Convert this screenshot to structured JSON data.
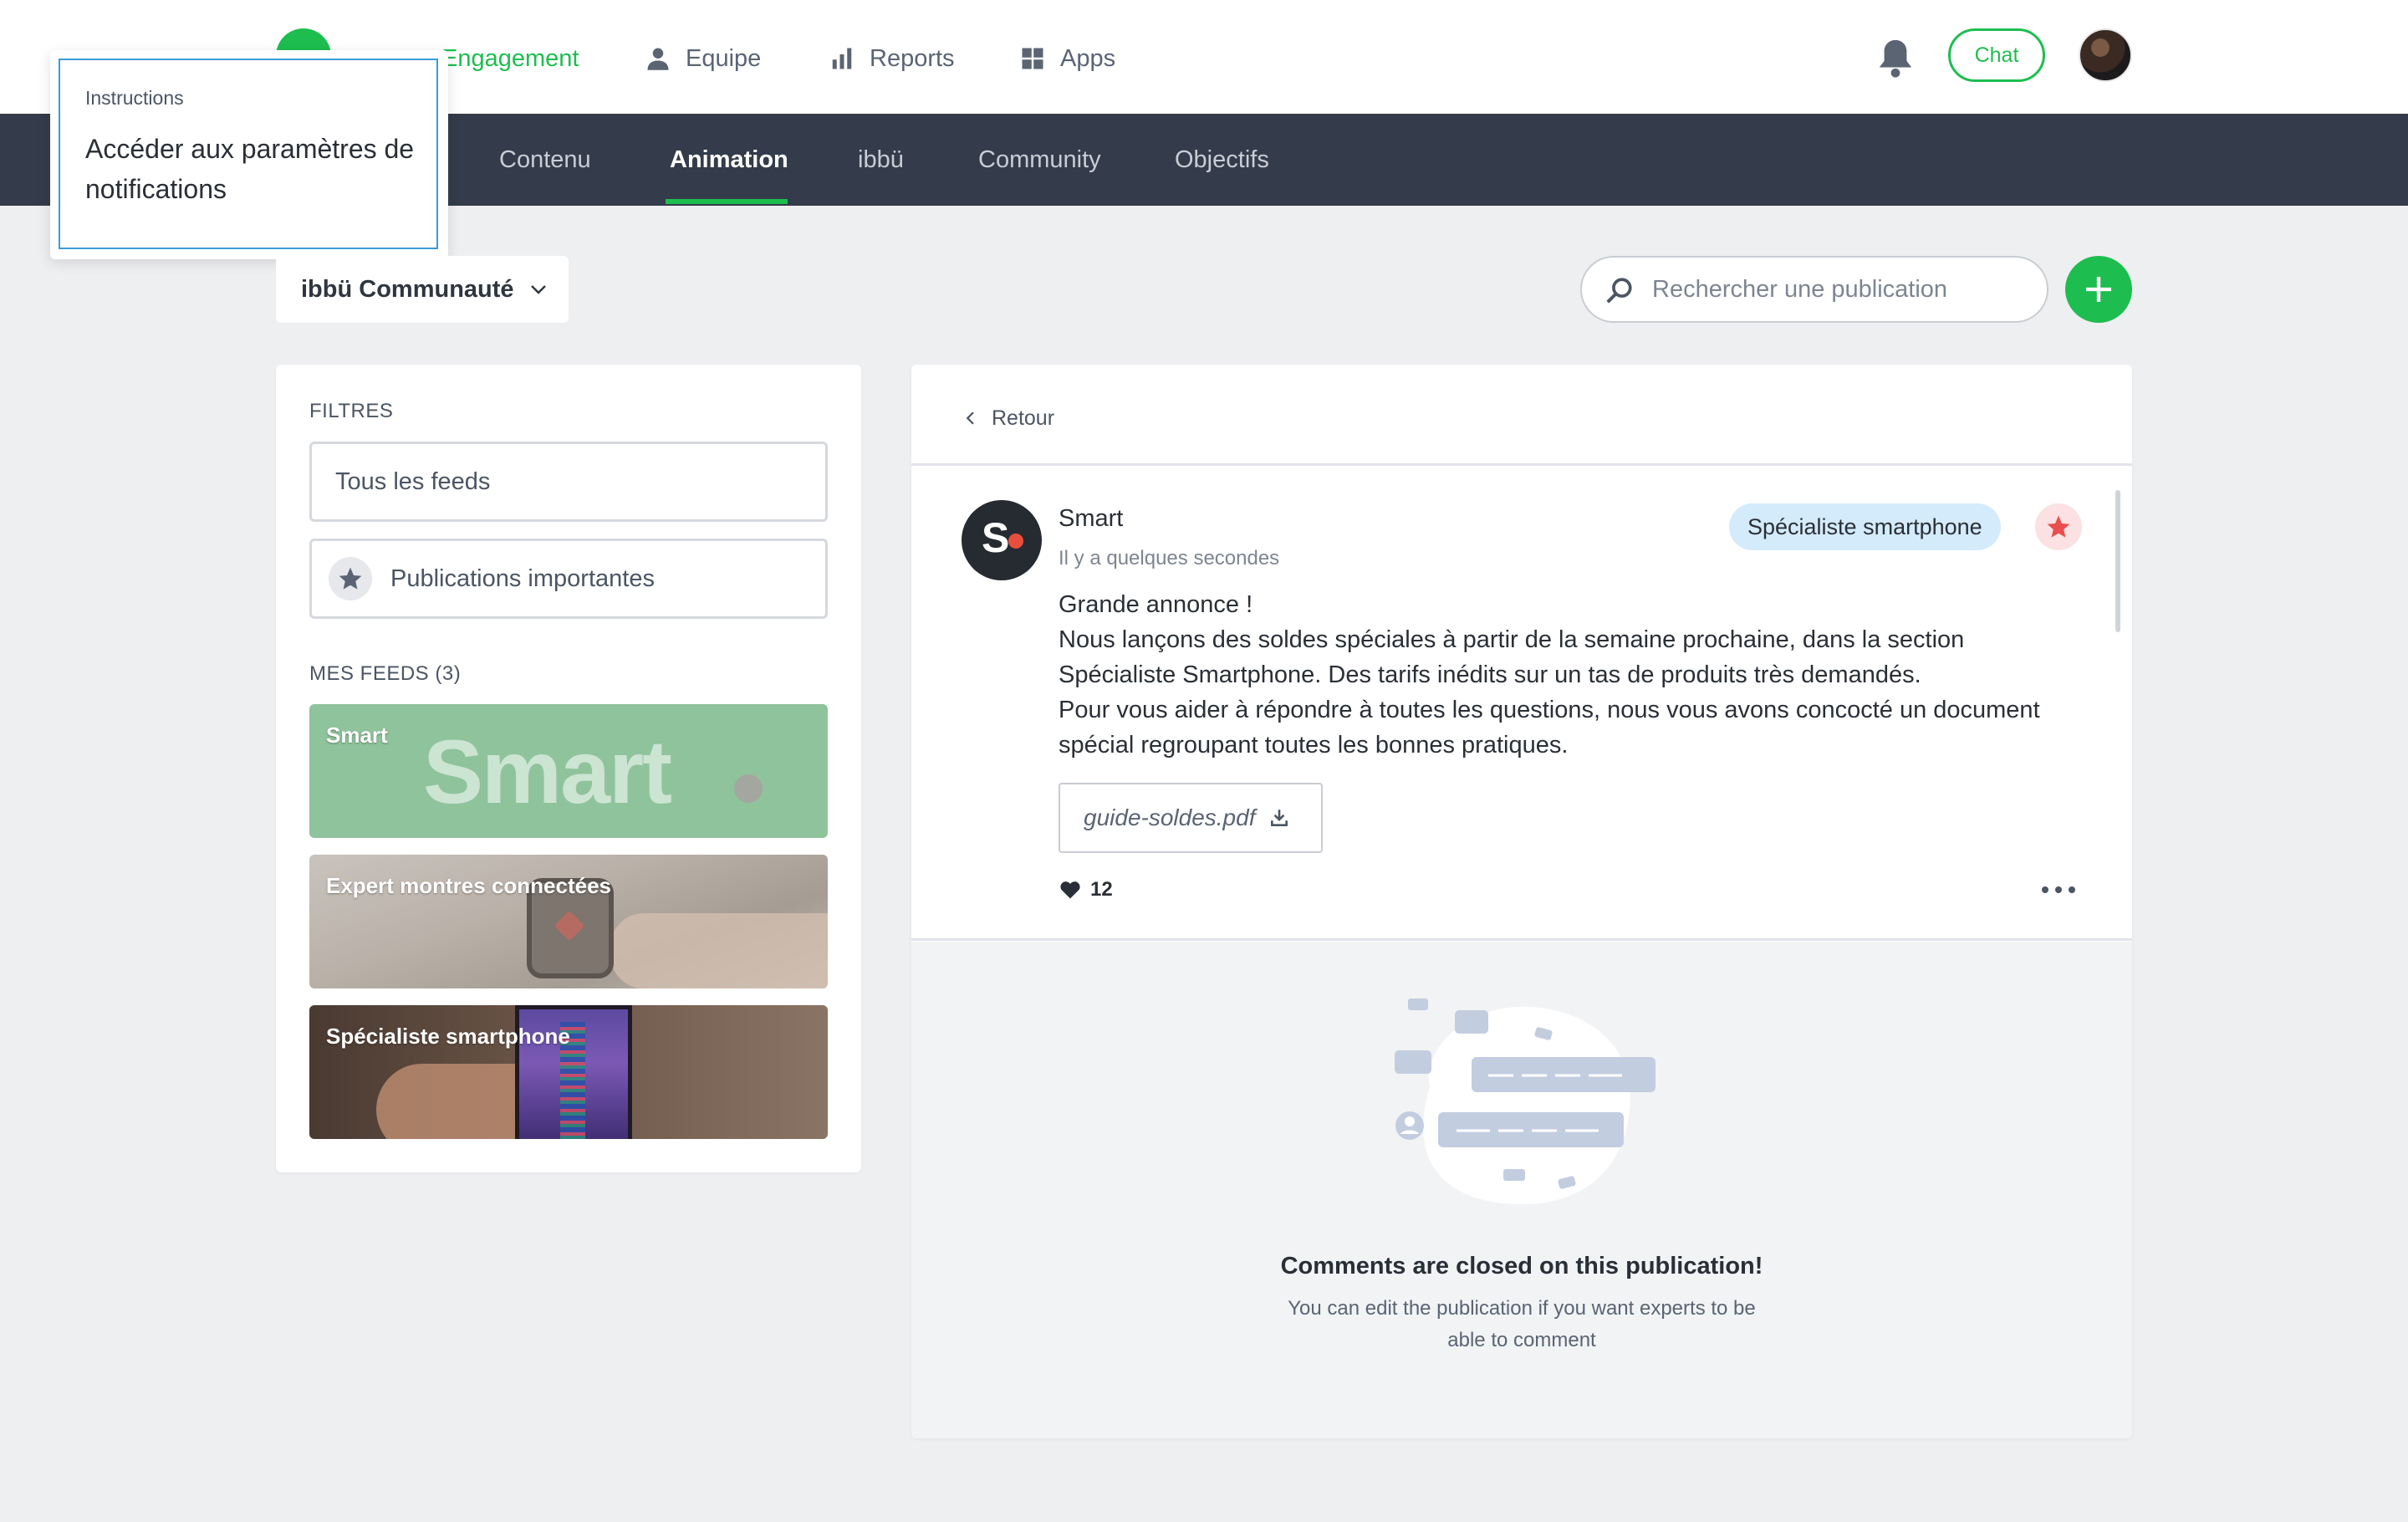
{
  "topnav": {
    "items": [
      {
        "label": "Engagement",
        "icon": "chat-icon",
        "active": true
      },
      {
        "label": "Equipe",
        "icon": "person-icon",
        "active": false
      },
      {
        "label": "Reports",
        "icon": "bar-chart-icon",
        "active": false
      },
      {
        "label": "Apps",
        "icon": "grid-icon",
        "active": false
      }
    ],
    "chat_label": "Chat"
  },
  "subnav": {
    "items": [
      "Contenu",
      "Animation",
      "ibbü",
      "Community",
      "Objectifs"
    ],
    "active": "Animation"
  },
  "instructions": {
    "label": "Instructions",
    "text": "Accéder aux paramètres de notifications"
  },
  "community_select": {
    "value": "ibbü Communauté"
  },
  "search": {
    "placeholder": "Rechercher une publication"
  },
  "filters": {
    "title": "FILTRES",
    "all_feeds": "Tous les feeds",
    "important": "Publications importantes",
    "my_feeds_title": "MES FEEDS (3)",
    "feeds": [
      {
        "name": "Smart",
        "logo_text": "Smart"
      },
      {
        "name": "Expert montres connectées"
      },
      {
        "name": "Spécialiste smartphone"
      }
    ]
  },
  "post": {
    "back_label": "Retour",
    "author": "Smart",
    "time": "Il y a quelques secondes",
    "tag": "Spécialiste smartphone",
    "lines": [
      "Grande annonce !",
      "Nous lançons des soldes spéciales à partir de la semaine prochaine, dans la section Spécialiste Smartphone. Des tarifs inédits sur un tas de produits très demandés.",
      "Pour vous aider à répondre à toutes les questions, nous vous avons concocté un document spécial regroupant toutes les bonnes pratiques."
    ],
    "attachment": "guide-soldes.pdf",
    "likes": "12"
  },
  "comments": {
    "closed_title": "Comments are closed on this publication!",
    "closed_sub": "You can edit the publication if you want experts to be able to comment"
  },
  "colors": {
    "accent": "#1dbe4f",
    "subnav_bg": "#343b4a",
    "tag_bg": "#d4ebfb",
    "favorite": "#e94e4e"
  }
}
